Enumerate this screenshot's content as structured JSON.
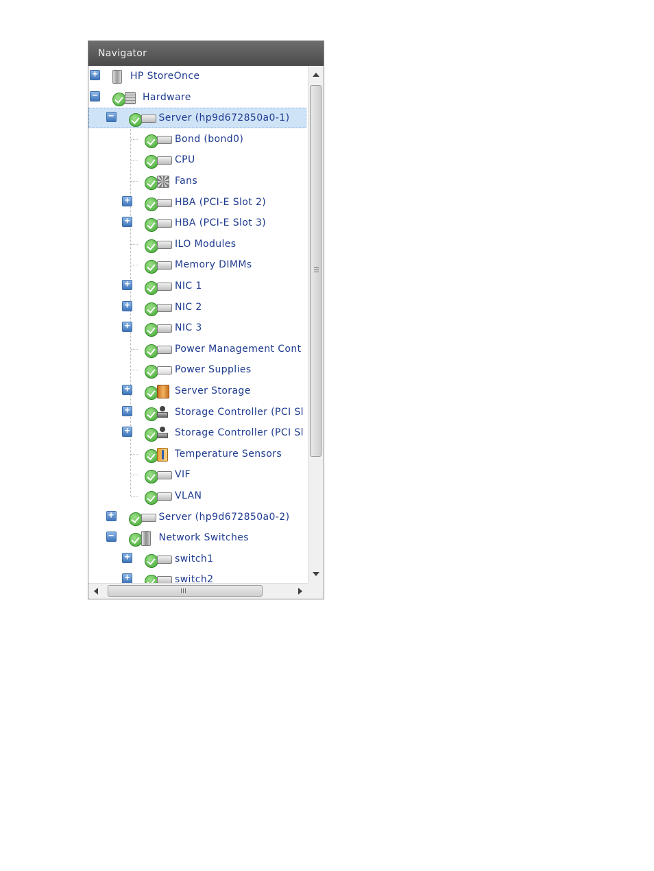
{
  "navigator": {
    "title": "Navigator",
    "tree": [
      {
        "label": "HP StoreOnce",
        "level": 0,
        "toggle": "+",
        "icon": "storeonce-appliance-icon",
        "status": false
      },
      {
        "label": "Hardware",
        "level": 0,
        "toggle": "−",
        "icon": "hardware-rack-icon",
        "status": true
      },
      {
        "label": "Server (hp9d672850a0-1)",
        "level": 1,
        "toggle": "−",
        "icon": "server-icon",
        "status": true,
        "selected": true
      },
      {
        "label": "Bond (bond0)",
        "level": 2,
        "toggle": "",
        "icon": "device-icon",
        "status": true
      },
      {
        "label": "CPU",
        "level": 2,
        "toggle": "",
        "icon": "device-icon",
        "status": true
      },
      {
        "label": "Fans",
        "level": 2,
        "toggle": "",
        "icon": "fan-icon",
        "status": true
      },
      {
        "label": "HBA (PCI-E Slot 2)",
        "level": 2,
        "toggle": "+",
        "icon": "device-icon",
        "status": true
      },
      {
        "label": "HBA (PCI-E Slot 3)",
        "level": 2,
        "toggle": "+",
        "icon": "device-icon",
        "status": true
      },
      {
        "label": "ILO Modules",
        "level": 2,
        "toggle": "",
        "icon": "device-icon",
        "status": true
      },
      {
        "label": "Memory DIMMs",
        "level": 2,
        "toggle": "",
        "icon": "device-icon",
        "status": true
      },
      {
        "label": "NIC 1",
        "level": 2,
        "toggle": "+",
        "icon": "device-icon",
        "status": true
      },
      {
        "label": "NIC 2",
        "level": 2,
        "toggle": "+",
        "icon": "device-icon",
        "status": true
      },
      {
        "label": "NIC 3",
        "level": 2,
        "toggle": "+",
        "icon": "device-icon",
        "status": true
      },
      {
        "label": "Power Management Cont",
        "level": 2,
        "toggle": "",
        "icon": "device-icon",
        "status": true
      },
      {
        "label": "Power Supplies",
        "level": 2,
        "toggle": "",
        "icon": "power-supply-icon",
        "status": true
      },
      {
        "label": "Server Storage",
        "level": 2,
        "toggle": "+",
        "icon": "storage-icon",
        "status": true
      },
      {
        "label": "Storage Controller (PCI Sl",
        "level": 2,
        "toggle": "+",
        "icon": "storage-controller-icon",
        "status": true
      },
      {
        "label": "Storage Controller (PCI Sl",
        "level": 2,
        "toggle": "+",
        "icon": "storage-controller-icon",
        "status": true
      },
      {
        "label": "Temperature Sensors",
        "level": 2,
        "toggle": "",
        "icon": "temperature-icon",
        "status": true
      },
      {
        "label": "VIF",
        "level": 2,
        "toggle": "",
        "icon": "device-icon",
        "status": true
      },
      {
        "label": "VLAN",
        "level": 2,
        "toggle": "",
        "icon": "device-icon",
        "status": true
      },
      {
        "label": "Server (hp9d672850a0-2)",
        "level": 1,
        "toggle": "+",
        "icon": "server-icon",
        "status": true
      },
      {
        "label": "Network Switches",
        "level": 1,
        "toggle": "−",
        "icon": "switch-cabinet-icon",
        "status": true
      },
      {
        "label": "switch1",
        "level": 2,
        "toggle": "+",
        "icon": "device-icon",
        "status": true
      },
      {
        "label": "switch2",
        "level": 2,
        "toggle": "+",
        "icon": "device-icon",
        "status": true
      }
    ]
  },
  "colors": {
    "label_text": "#1d3a8f",
    "selected_bg": "#cfe3f7",
    "title_bar": "#555555",
    "status_ok": "#3fa531"
  },
  "scrollbars": {
    "vertical": {
      "up_icon": "scroll-up-arrow-icon",
      "down_icon": "scroll-down-arrow-icon"
    },
    "horizontal": {
      "left_icon": "scroll-left-arrow-icon",
      "right_icon": "scroll-right-arrow-icon"
    }
  }
}
